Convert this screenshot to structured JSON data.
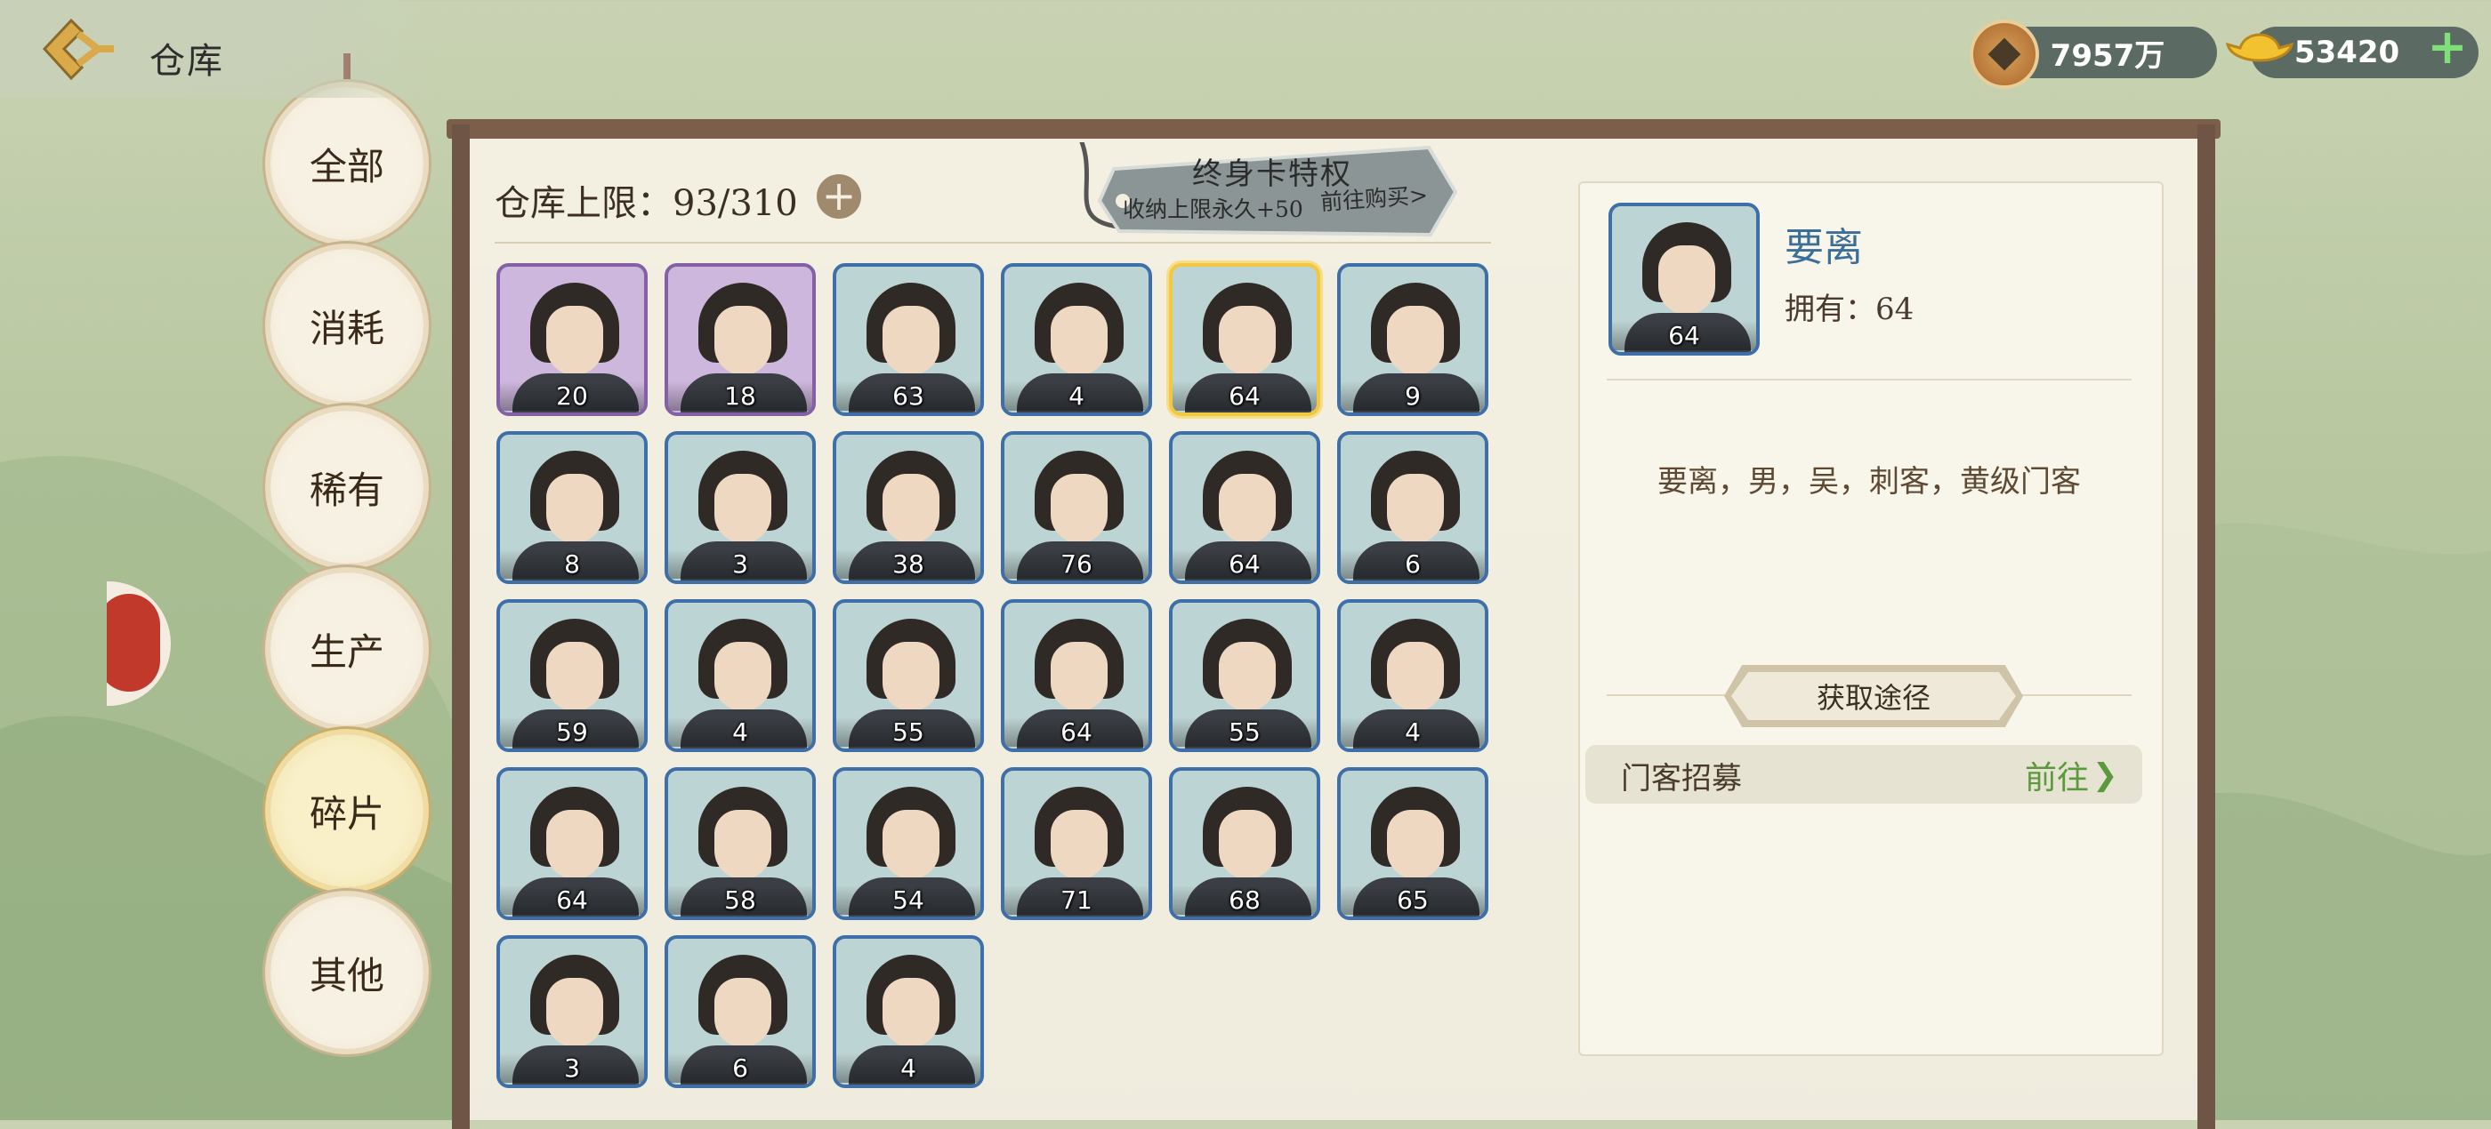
{
  "header": {
    "title": "仓库"
  },
  "currency": {
    "copper": "7957万",
    "gold": "53420"
  },
  "tabs": [
    {
      "label": "全部",
      "active": false
    },
    {
      "label": "消耗",
      "active": false
    },
    {
      "label": "稀有",
      "active": false
    },
    {
      "label": "生产",
      "active": false
    },
    {
      "label": "碎片",
      "active": true
    },
    {
      "label": "其他",
      "active": false
    }
  ],
  "storage": {
    "label": "仓库上限：93/310"
  },
  "promo": {
    "title": "终身卡特权",
    "subtitle": "收纳上限永久+50",
    "link": "前往购买>"
  },
  "items": [
    {
      "count": "20",
      "frame": "purple"
    },
    {
      "count": "18",
      "frame": "purple"
    },
    {
      "count": "63",
      "frame": "blue"
    },
    {
      "count": "4",
      "frame": "blue"
    },
    {
      "count": "64",
      "frame": "selected"
    },
    {
      "count": "9",
      "frame": "blue"
    },
    {
      "count": "8",
      "frame": "blue"
    },
    {
      "count": "3",
      "frame": "blue"
    },
    {
      "count": "38",
      "frame": "blue"
    },
    {
      "count": "76",
      "frame": "blue"
    },
    {
      "count": "64",
      "frame": "blue"
    },
    {
      "count": "6",
      "frame": "blue"
    },
    {
      "count": "59",
      "frame": "blue"
    },
    {
      "count": "4",
      "frame": "blue"
    },
    {
      "count": "55",
      "frame": "blue"
    },
    {
      "count": "64",
      "frame": "blue"
    },
    {
      "count": "55",
      "frame": "blue"
    },
    {
      "count": "4",
      "frame": "blue"
    },
    {
      "count": "64",
      "frame": "blue"
    },
    {
      "count": "58",
      "frame": "blue"
    },
    {
      "count": "54",
      "frame": "blue"
    },
    {
      "count": "71",
      "frame": "blue"
    },
    {
      "count": "68",
      "frame": "blue"
    },
    {
      "count": "65",
      "frame": "blue"
    },
    {
      "count": "3",
      "frame": "blue"
    },
    {
      "count": "6",
      "frame": "blue"
    },
    {
      "count": "4",
      "frame": "blue"
    }
  ],
  "detail": {
    "name": "要离",
    "count": "64",
    "owned": "拥有：64",
    "description": "要离，男，吴，刺客，黄级门客",
    "source_header": "获取途径",
    "sources": [
      {
        "name": "门客招募",
        "action": "前往"
      }
    ]
  },
  "colors": {
    "purple_frame": "#8460a6",
    "blue_frame": "#3f6fa8",
    "selected_frame": "#f2c842",
    "go_green": "#5b9a3c"
  }
}
